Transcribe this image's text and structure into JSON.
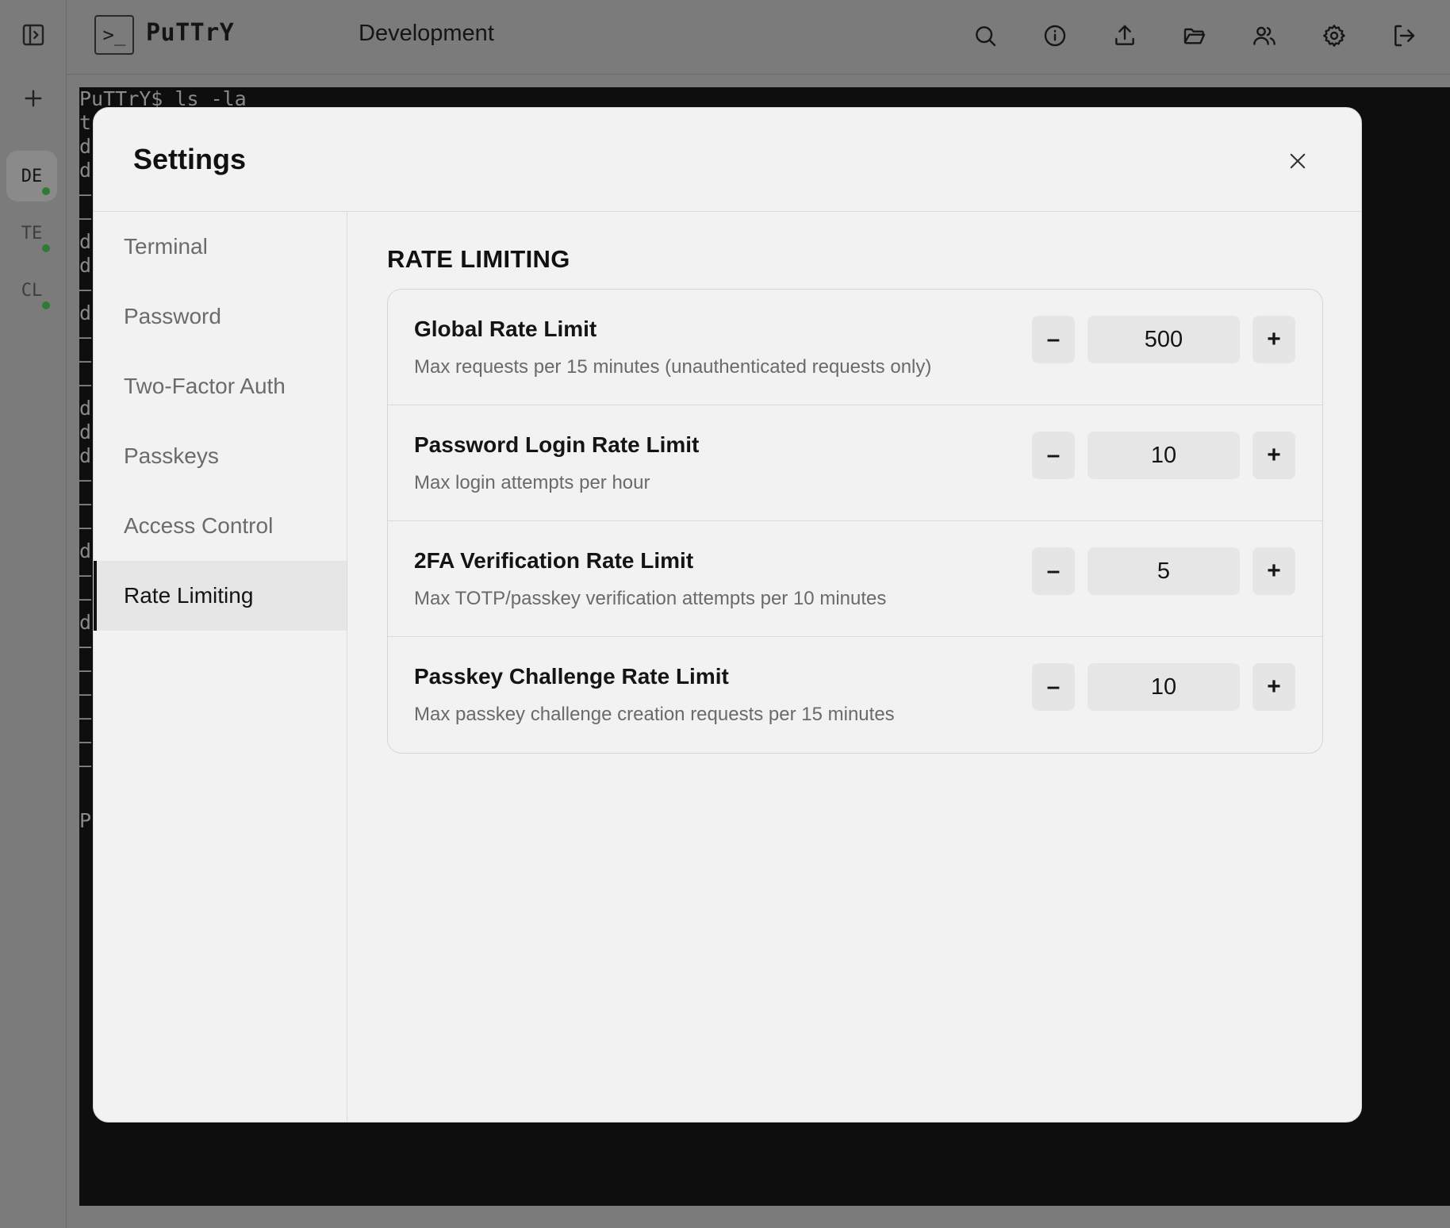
{
  "app": {
    "brand": "PuTTrY",
    "logo_glyph": ">_",
    "session_title": "Development"
  },
  "rail": {
    "tabs": [
      {
        "label": "DE",
        "active": true,
        "status_color": "#2f7a35"
      },
      {
        "label": "TE",
        "active": false,
        "status_color": "#2f7a35"
      },
      {
        "label": "CL",
        "active": false,
        "status_color": "#2f7a35"
      }
    ]
  },
  "toolbar_icons": [
    "search-icon",
    "info-icon",
    "upload-icon",
    "folder-icon",
    "users-icon",
    "settings-icon",
    "logout-icon"
  ],
  "terminal": {
    "prompt_line": "PuTTrY$ ls -la",
    "visible_fragments": [
      "t",
      "d",
      "d",
      "–",
      "–",
      "d",
      "d",
      "–",
      "d",
      "–",
      "–",
      "–",
      "d",
      "d",
      "d",
      "–",
      "–",
      "–",
      "d",
      "–",
      "–",
      "d",
      "–",
      "–",
      "–",
      "–",
      "–",
      "–",
      "P"
    ]
  },
  "settings": {
    "title": "Settings",
    "nav": [
      {
        "label": "Terminal",
        "active": false
      },
      {
        "label": "Password",
        "active": false
      },
      {
        "label": "Two-Factor Auth",
        "active": false
      },
      {
        "label": "Passkeys",
        "active": false
      },
      {
        "label": "Access Control",
        "active": false
      },
      {
        "label": "Rate Limiting",
        "active": true
      }
    ],
    "section_title": "RATE LIMITING",
    "rows": [
      {
        "title": "Global Rate Limit",
        "description": "Max requests per 15 minutes (unauthenticated requests only)",
        "value": "500"
      },
      {
        "title": "Password Login Rate Limit",
        "description": "Max login attempts per hour",
        "value": "10"
      },
      {
        "title": "2FA Verification Rate Limit",
        "description": "Max TOTP/passkey verification attempts per 10 minutes",
        "value": "5"
      },
      {
        "title": "Passkey Challenge Rate Limit",
        "description": "Max passkey challenge creation requests per 15 minutes",
        "value": "10"
      }
    ],
    "minus_label": "–",
    "plus_label": "+"
  }
}
